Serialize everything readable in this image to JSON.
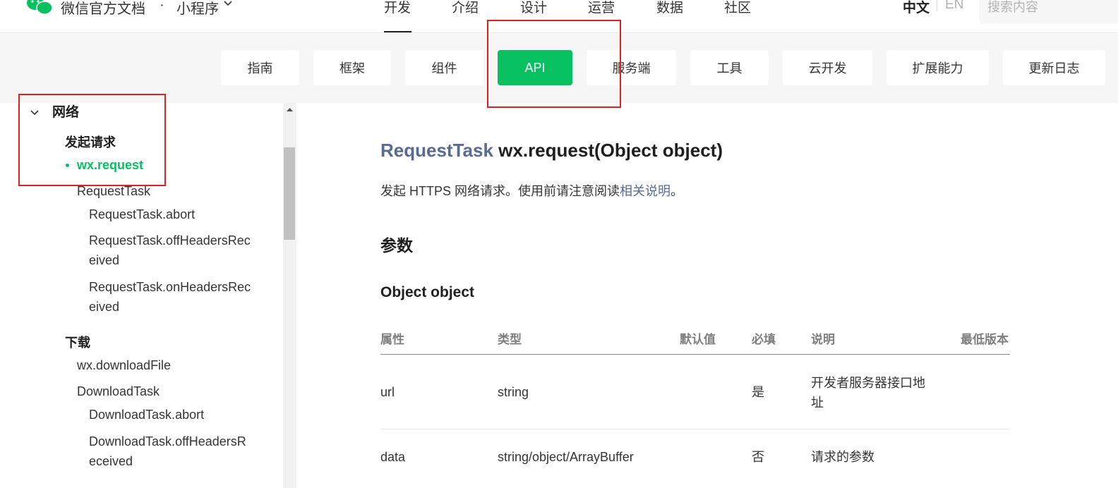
{
  "header": {
    "brand": "微信官方文档",
    "separator": "·",
    "product": "小程序",
    "nav": [
      "开发",
      "介绍",
      "设计",
      "运营",
      "数据",
      "社区"
    ],
    "lang_zh": "中文",
    "lang_en": "EN",
    "search_placeholder": "搜索内容"
  },
  "subnav": {
    "tabs": [
      "指南",
      "框架",
      "组件",
      "API",
      "服务端",
      "工具",
      "云开发",
      "扩展能力",
      "更新日志"
    ],
    "active": "API"
  },
  "sidebar": {
    "group": "网络",
    "section1": "发起请求",
    "items1": [
      "wx.request",
      "RequestTask",
      "RequestTask.abort",
      "RequestTask.offHeadersRec",
      "eived",
      "RequestTask.onHeadersRec",
      "eived"
    ],
    "section2": "下载",
    "items2": [
      "wx.downloadFile",
      "DownloadTask",
      "DownloadTask.abort",
      "DownloadTask.offHeadersR",
      "eceived"
    ]
  },
  "content": {
    "title_type": "RequestTask",
    "title_sig": "wx.request(Object object)",
    "desc_prefix": "发起 HTTPS 网络请求。使用前请注意阅读",
    "desc_link": "相关说明",
    "desc_suffix": "。",
    "params_heading": "参数",
    "object_heading": "Object object",
    "table": {
      "headers": [
        "属性",
        "类型",
        "默认值",
        "必填",
        "说明",
        "最低版本"
      ],
      "rows": [
        {
          "name": "url",
          "type": "string",
          "default": "",
          "required": "是",
          "desc_line1": "开发者服务器接口地",
          "desc_line2": "址",
          "version": ""
        },
        {
          "name": "data",
          "type": "string/object/ArrayBuffer",
          "default": "",
          "required": "否",
          "desc_line1": "请求的参数",
          "desc_line2": "",
          "version": ""
        }
      ]
    }
  },
  "colors": {
    "accent": "#07c160",
    "link": "#576b95",
    "highlight": "#e02020"
  }
}
